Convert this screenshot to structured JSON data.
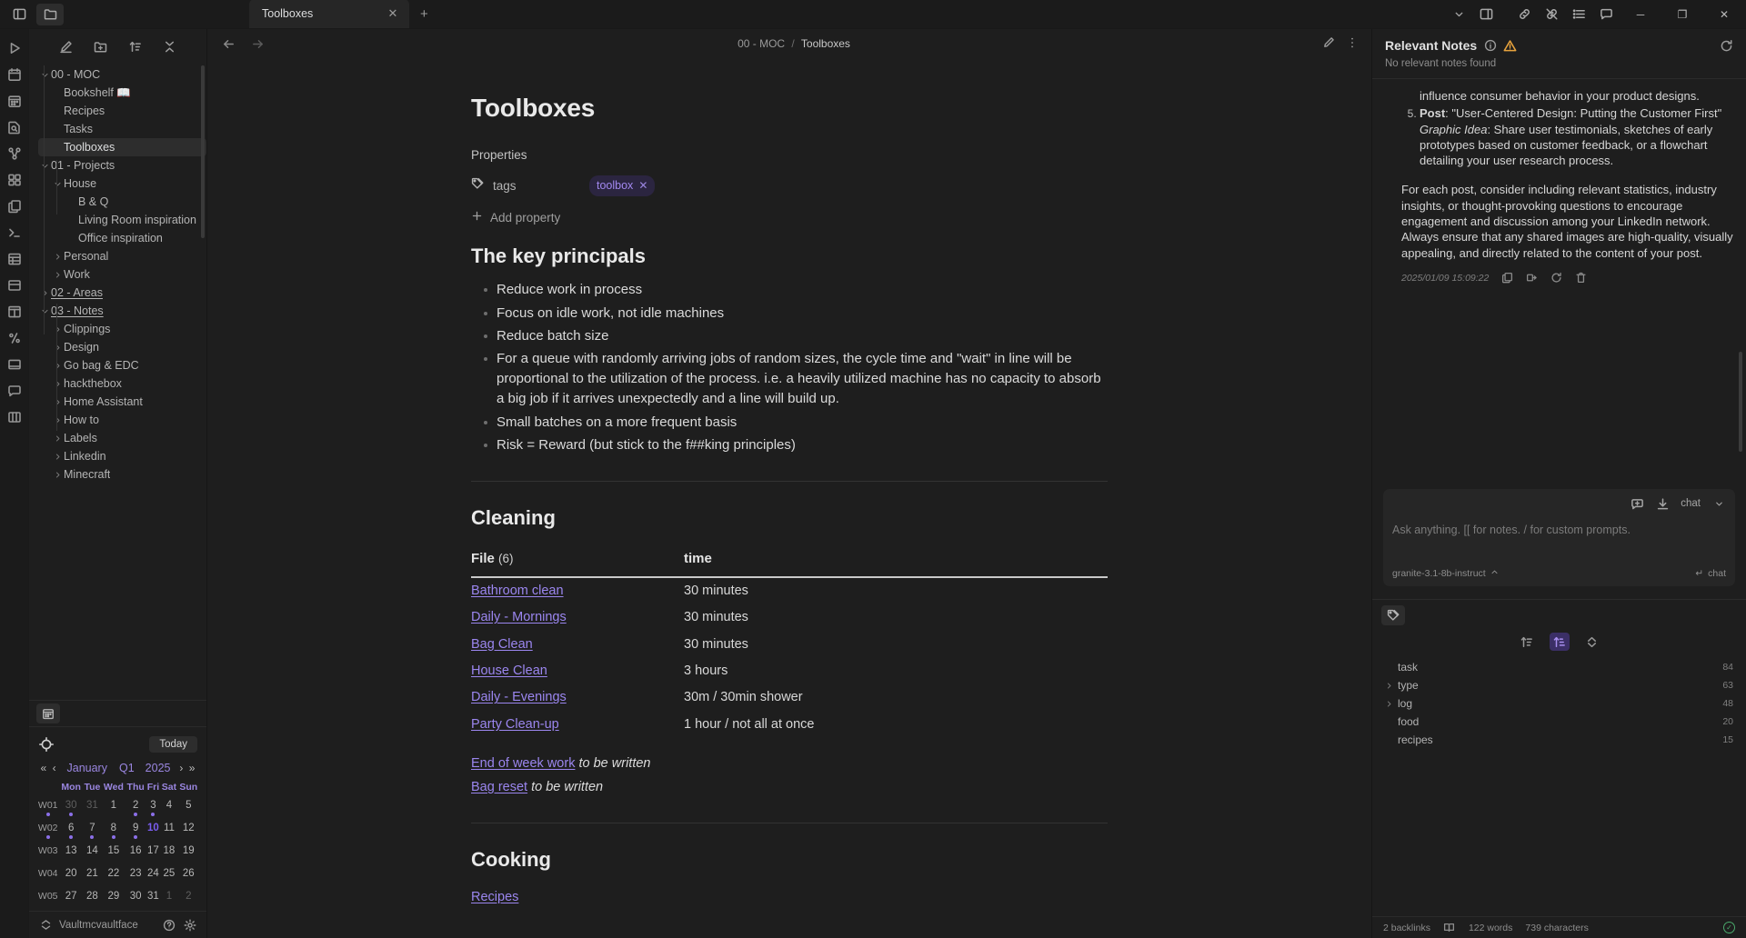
{
  "titlebar": {
    "tab_title": "Toolboxes",
    "close_label": "✕",
    "new_tab_label": "+",
    "minimize_label": "─",
    "maximize_label": "❐",
    "window_close_label": "✕"
  },
  "sidebar": {
    "tree": [
      {
        "label": "00 - MOC",
        "indent": 1,
        "chev": "down",
        "underline": false,
        "selected": false
      },
      {
        "label": "Bookshelf 📖",
        "indent": 2,
        "chev": "none",
        "underline": false,
        "selected": false
      },
      {
        "label": "Recipes",
        "indent": 2,
        "chev": "none",
        "underline": false,
        "selected": false
      },
      {
        "label": "Tasks",
        "indent": 2,
        "chev": "none",
        "underline": false,
        "selected": false
      },
      {
        "label": "Toolboxes",
        "indent": 2,
        "chev": "none",
        "underline": false,
        "selected": true
      },
      {
        "label": "01 - Projects",
        "indent": 1,
        "chev": "down",
        "underline": false,
        "selected": false
      },
      {
        "label": "House",
        "indent": 2,
        "chev": "down",
        "underline": false,
        "selected": false
      },
      {
        "label": "B & Q",
        "indent": 3,
        "chev": "none",
        "underline": false,
        "selected": false
      },
      {
        "label": "Living Room inspiration",
        "indent": 3,
        "chev": "none",
        "underline": false,
        "selected": false
      },
      {
        "label": "Office inspiration",
        "indent": 3,
        "chev": "none",
        "underline": false,
        "selected": false
      },
      {
        "label": "Personal",
        "indent": 2,
        "chev": "right",
        "underline": false,
        "selected": false
      },
      {
        "label": "Work",
        "indent": 2,
        "chev": "right",
        "underline": false,
        "selected": false
      },
      {
        "label": "02 - Areas",
        "indent": 1,
        "chev": "right",
        "underline": true,
        "selected": false
      },
      {
        "label": "03 - Notes",
        "indent": 1,
        "chev": "down",
        "underline": true,
        "selected": false
      },
      {
        "label": "Clippings",
        "indent": 2,
        "chev": "right",
        "underline": false,
        "selected": false
      },
      {
        "label": "Design",
        "indent": 2,
        "chev": "right",
        "underline": false,
        "selected": false
      },
      {
        "label": "Go bag & EDC",
        "indent": 2,
        "chev": "right",
        "underline": false,
        "selected": false
      },
      {
        "label": "hackthebox",
        "indent": 2,
        "chev": "right",
        "underline": false,
        "selected": false
      },
      {
        "label": "Home Assistant",
        "indent": 2,
        "chev": "right",
        "underline": false,
        "selected": false
      },
      {
        "label": "How to",
        "indent": 2,
        "chev": "right",
        "underline": false,
        "selected": false
      },
      {
        "label": "Labels",
        "indent": 2,
        "chev": "right",
        "underline": false,
        "selected": false
      },
      {
        "label": "Linkedin",
        "indent": 2,
        "chev": "right",
        "underline": false,
        "selected": false
      },
      {
        "label": "Minecraft",
        "indent": 2,
        "chev": "right",
        "underline": false,
        "selected": false
      }
    ],
    "vault": {
      "name": "Vaultmcvaultface"
    }
  },
  "calendar": {
    "today_label": "Today",
    "prev_year": "«",
    "prev_month": "‹",
    "month": "January",
    "quarter": "Q1",
    "year": "2025",
    "next_month": "›",
    "next_year": "»",
    "weekday_headers": [
      "",
      "Mon",
      "Tue",
      "Wed",
      "Thu",
      "Fri",
      "Sat",
      "Sun"
    ],
    "weeks": [
      {
        "wk": "W01",
        "wk_dot": true,
        "days": [
          {
            "n": "30",
            "dim": true,
            "dot": true,
            "today": false
          },
          {
            "n": "31",
            "dim": true,
            "dot": false,
            "today": false
          },
          {
            "n": "1",
            "dim": false,
            "dot": false,
            "today": false
          },
          {
            "n": "2",
            "dim": false,
            "dot": true,
            "today": false
          },
          {
            "n": "3",
            "dim": false,
            "dot": true,
            "today": false
          },
          {
            "n": "4",
            "dim": false,
            "dot": false,
            "today": false
          },
          {
            "n": "5",
            "dim": false,
            "dot": false,
            "today": false
          }
        ]
      },
      {
        "wk": "W02",
        "wk_dot": true,
        "days": [
          {
            "n": "6",
            "dim": false,
            "dot": true,
            "today": false
          },
          {
            "n": "7",
            "dim": false,
            "dot": true,
            "today": false
          },
          {
            "n": "8",
            "dim": false,
            "dot": true,
            "today": false
          },
          {
            "n": "9",
            "dim": false,
            "dot": true,
            "today": false
          },
          {
            "n": "10",
            "dim": false,
            "dot": false,
            "today": true
          },
          {
            "n": "11",
            "dim": false,
            "dot": false,
            "today": false
          },
          {
            "n": "12",
            "dim": false,
            "dot": false,
            "today": false
          }
        ]
      },
      {
        "wk": "W03",
        "wk_dot": false,
        "days": [
          {
            "n": "13",
            "dim": false,
            "dot": false,
            "today": false
          },
          {
            "n": "14",
            "dim": false,
            "dot": false,
            "today": false
          },
          {
            "n": "15",
            "dim": false,
            "dot": false,
            "today": false
          },
          {
            "n": "16",
            "dim": false,
            "dot": false,
            "today": false
          },
          {
            "n": "17",
            "dim": false,
            "dot": false,
            "today": false
          },
          {
            "n": "18",
            "dim": false,
            "dot": false,
            "today": false
          },
          {
            "n": "19",
            "dim": false,
            "dot": false,
            "today": false
          }
        ]
      },
      {
        "wk": "W04",
        "wk_dot": false,
        "days": [
          {
            "n": "20",
            "dim": false,
            "dot": false,
            "today": false
          },
          {
            "n": "21",
            "dim": false,
            "dot": false,
            "today": false
          },
          {
            "n": "22",
            "dim": false,
            "dot": false,
            "today": false
          },
          {
            "n": "23",
            "dim": false,
            "dot": false,
            "today": false
          },
          {
            "n": "24",
            "dim": false,
            "dot": false,
            "today": false
          },
          {
            "n": "25",
            "dim": false,
            "dot": false,
            "today": false
          },
          {
            "n": "26",
            "dim": false,
            "dot": false,
            "today": false
          }
        ]
      },
      {
        "wk": "W05",
        "wk_dot": false,
        "days": [
          {
            "n": "27",
            "dim": false,
            "dot": false,
            "today": false
          },
          {
            "n": "28",
            "dim": false,
            "dot": false,
            "today": false
          },
          {
            "n": "29",
            "dim": false,
            "dot": false,
            "today": false
          },
          {
            "n": "30",
            "dim": false,
            "dot": false,
            "today": false
          },
          {
            "n": "31",
            "dim": false,
            "dot": false,
            "today": false
          },
          {
            "n": "1",
            "dim": true,
            "dot": false,
            "today": false
          },
          {
            "n": "2",
            "dim": true,
            "dot": false,
            "today": false
          }
        ]
      }
    ]
  },
  "main": {
    "breadcrumb_root": "00 - MOC",
    "breadcrumb_sep": "/",
    "breadcrumb_current": "Toolboxes",
    "note": {
      "title": "Toolboxes",
      "properties_label": "Properties",
      "prop_key": "tags",
      "prop_tag": "toolbox",
      "prop_tag_remove": "✕",
      "add_property": "Add property",
      "h2_principals": "The key principals",
      "principals": [
        "Reduce work in process",
        "Focus on idle work, not idle machines",
        "Reduce batch size",
        "For a queue with randomly arriving jobs of random sizes, the cycle time and \"wait\" in line will be proportional to the utilization of the process. i.e. a heavily utilized machine has no capacity to absorb a big job if it arrives unexpectedly and a line will build up.",
        "Small batches on a more frequent basis",
        "Risk = Reward (but stick to the f##king principles)"
      ],
      "h2_cleaning": "Cleaning",
      "table": {
        "col_file": "File",
        "col_file_count": "(6)",
        "col_time": "time",
        "rows": [
          {
            "file": "Bathroom clean",
            "time": "30 minutes"
          },
          {
            "file": "Daily - Mornings",
            "time": "30 minutes"
          },
          {
            "file": "Bag Clean",
            "time": "30 minutes"
          },
          {
            "file": "House Clean",
            "time": "3 hours"
          },
          {
            "file": "Daily - Evenings",
            "time": "30m / 30min shower"
          },
          {
            "file": "Party Clean-up",
            "time": "1 hour / not all at once"
          }
        ]
      },
      "after_table": [
        {
          "link": "End of week work",
          "rest": "to be written"
        },
        {
          "link": "Bag reset",
          "rest": "to be written"
        }
      ],
      "h2_cooking": "Cooking",
      "cooking_link": "Recipes"
    }
  },
  "right": {
    "relevant_notes_title": "Relevant Notes",
    "relevant_notes_empty": "No relevant notes found",
    "chat": {
      "lead_text": "influence consumer behavior in your product designs.",
      "item_number": "5.",
      "item_bold": "Post",
      "item_rest": ": \"User-Centered Design: Putting the Customer First\"",
      "item_italic": "Graphic Idea",
      "item_italic_rest": ": Share user testimonials, sketches of early prototypes based on customer feedback, or a flowchart detailing your user research process.",
      "paragraph": "For each post, consider including relevant statistics, industry insights, or thought-provoking questions to encourage engagement and discussion among your LinkedIn network. Always ensure that any shared images are high-quality, visually appealing, and directly related to the content of your post.",
      "timestamp": "2025/01/09 15:09:22"
    },
    "composer": {
      "mode_label": "chat",
      "placeholder": "Ask anything. [[ for notes. / for custom prompts.",
      "model": "granite-3.1-8b-instruct",
      "send_label": "chat",
      "send_key": "↵"
    },
    "tags": {
      "items": [
        {
          "label": "task",
          "count": "84",
          "chev": false
        },
        {
          "label": "type",
          "count": "63",
          "chev": true
        },
        {
          "label": "log",
          "count": "48",
          "chev": true
        },
        {
          "label": "food",
          "count": "20",
          "chev": false
        },
        {
          "label": "recipes",
          "count": "15",
          "chev": false
        }
      ]
    },
    "status": {
      "backlinks": "2 backlinks",
      "words": "122 words",
      "chars": "739 characters"
    }
  }
}
